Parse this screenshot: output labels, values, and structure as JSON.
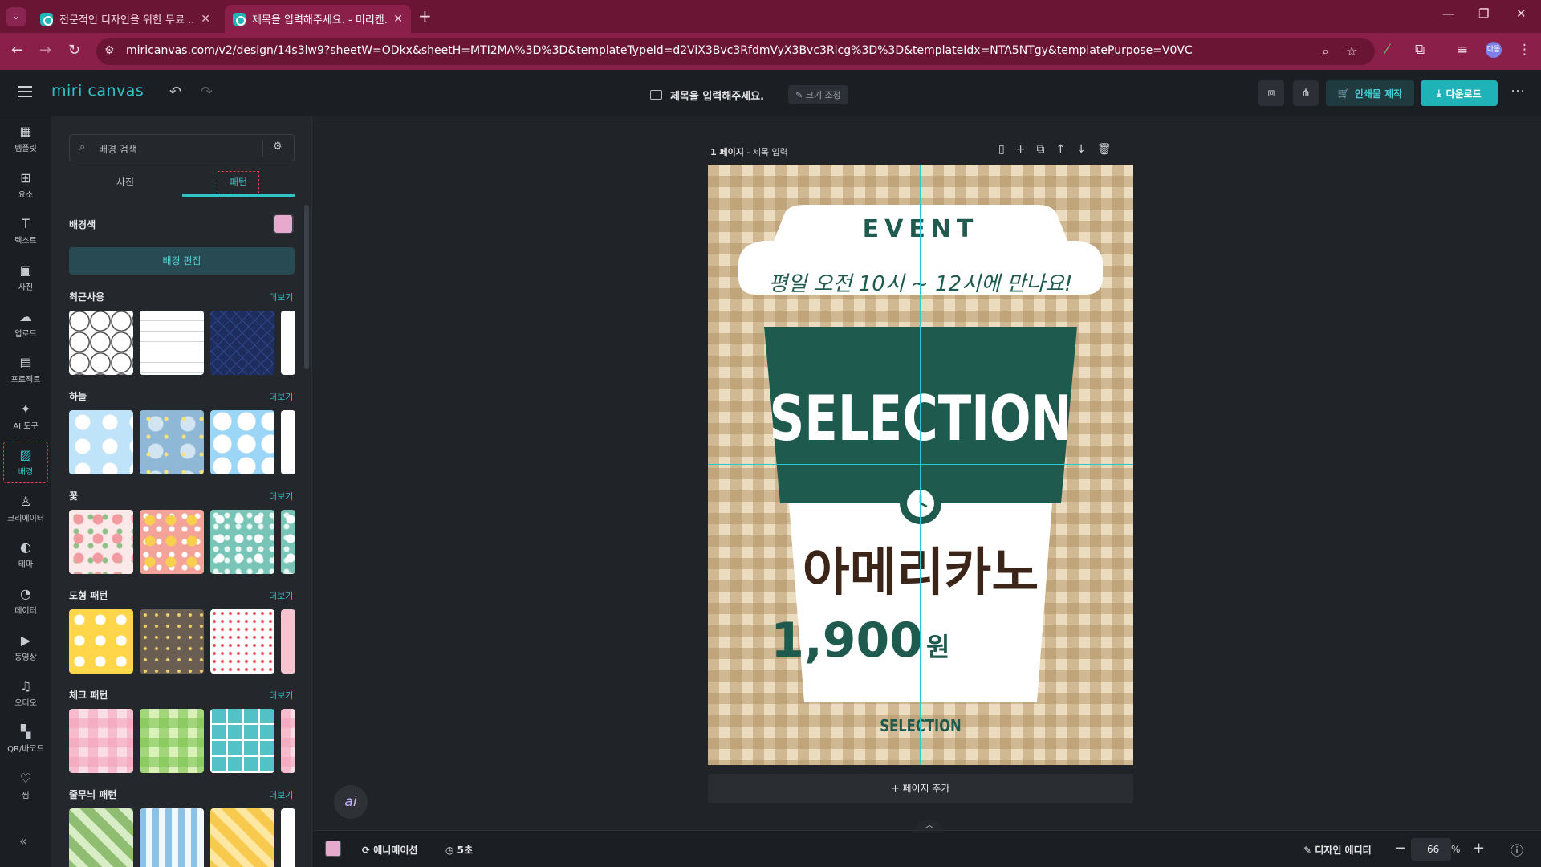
{
  "browser": {
    "tabs": [
      {
        "title": "전문적인 디자인을 위한 무료 ..."
      },
      {
        "title": "제목을 입력해주세요. - 미리캔..."
      }
    ],
    "url": "miricanvas.com/v2/design/14s3lw9?sheetW=ODkx&sheetH=MTI2MA%3D%3D&templateTypeId=d2ViX3Bvc3RfdmVyX3Bvc3Rlcg%3D%3D&templateIdx=NTA5NTgy&templatePurpose=V0VC",
    "profile_initials": "다동"
  },
  "header": {
    "logo": "miri canvas",
    "doc_title": "제목을 입력해주세요.",
    "resize_label": "크기 조정",
    "print_label": "인쇄물 제작",
    "download_label": "다운로드"
  },
  "rail": [
    {
      "label": "템플릿",
      "icon": "template-icon",
      "glyph": "▦"
    },
    {
      "label": "요소",
      "icon": "elements-icon",
      "glyph": "⊞"
    },
    {
      "label": "텍스트",
      "icon": "text-icon",
      "glyph": "T"
    },
    {
      "label": "사진",
      "icon": "photo-icon",
      "glyph": "▣"
    },
    {
      "label": "업로드",
      "icon": "upload-icon",
      "glyph": "☁"
    },
    {
      "label": "프로젝트",
      "icon": "project-icon",
      "glyph": "▤"
    },
    {
      "label": "AI 도구",
      "icon": "ai-tools-icon",
      "glyph": "✦"
    },
    {
      "label": "배경",
      "icon": "background-icon",
      "glyph": "▨"
    },
    {
      "label": "크리에이터",
      "icon": "creator-icon",
      "glyph": "♙"
    },
    {
      "label": "테마",
      "icon": "theme-icon",
      "glyph": "◐"
    },
    {
      "label": "데이터",
      "icon": "data-icon",
      "glyph": "◔"
    },
    {
      "label": "동영상",
      "icon": "video-icon",
      "glyph": "▶"
    },
    {
      "label": "오디오",
      "icon": "audio-icon",
      "glyph": "♫"
    },
    {
      "label": "QR/바코드",
      "icon": "qr-icon",
      "glyph": "▚"
    },
    {
      "label": "찜",
      "icon": "heart-icon",
      "glyph": "♡"
    }
  ],
  "panel": {
    "search_placeholder": "배경 검색",
    "tabs": [
      "사진",
      "패턴"
    ],
    "bgcolor_label": "배경색",
    "bgcolor_value": "#e8a9cf",
    "bgedit_label": "배경 편집",
    "more_label": "더보기",
    "sections": [
      {
        "title": "최근사용",
        "patterns": [
          "hexagon",
          "lines",
          "navy-lattice"
        ]
      },
      {
        "title": "하늘",
        "patterns": [
          "sky-clouds",
          "night-sky",
          "clouds"
        ]
      },
      {
        "title": "꽃",
        "patterns": [
          "pink-flowers",
          "coral-flowers",
          "mint-flowers"
        ]
      },
      {
        "title": "도형 패턴",
        "patterns": [
          "yellow-dots",
          "brown-dots",
          "red-dots"
        ]
      },
      {
        "title": "체크 패턴",
        "patterns": [
          "pink-check",
          "green-check",
          "teal-grid"
        ]
      },
      {
        "title": "줄무늬 패턴",
        "patterns": [
          "green-stripes",
          "blue-stripes",
          "yellow-stripes"
        ]
      }
    ]
  },
  "canvas": {
    "page_number": "1 페이지",
    "page_title": "제목 입력",
    "add_page_label": "페이지 추가",
    "design": {
      "event": "EVENT",
      "subtitle": "평일 오전 10시 ~ 12시에 만나요!",
      "selection": "SELECTION",
      "product": "아메리카노",
      "price": "1,900",
      "currency": "원",
      "footer": "SELECTION"
    }
  },
  "bottombar": {
    "animation_label": "애니메이션",
    "duration_label": "5초",
    "editor_label": "디자인 에디터",
    "zoom": "66",
    "zoom_unit": "%"
  },
  "colors": {
    "accent": "#2ec4c8",
    "cup_green": "#1f5a4e",
    "cup_white": "#ffffff",
    "price_text": "#1f5a4e",
    "product_text": "#3b2418"
  }
}
